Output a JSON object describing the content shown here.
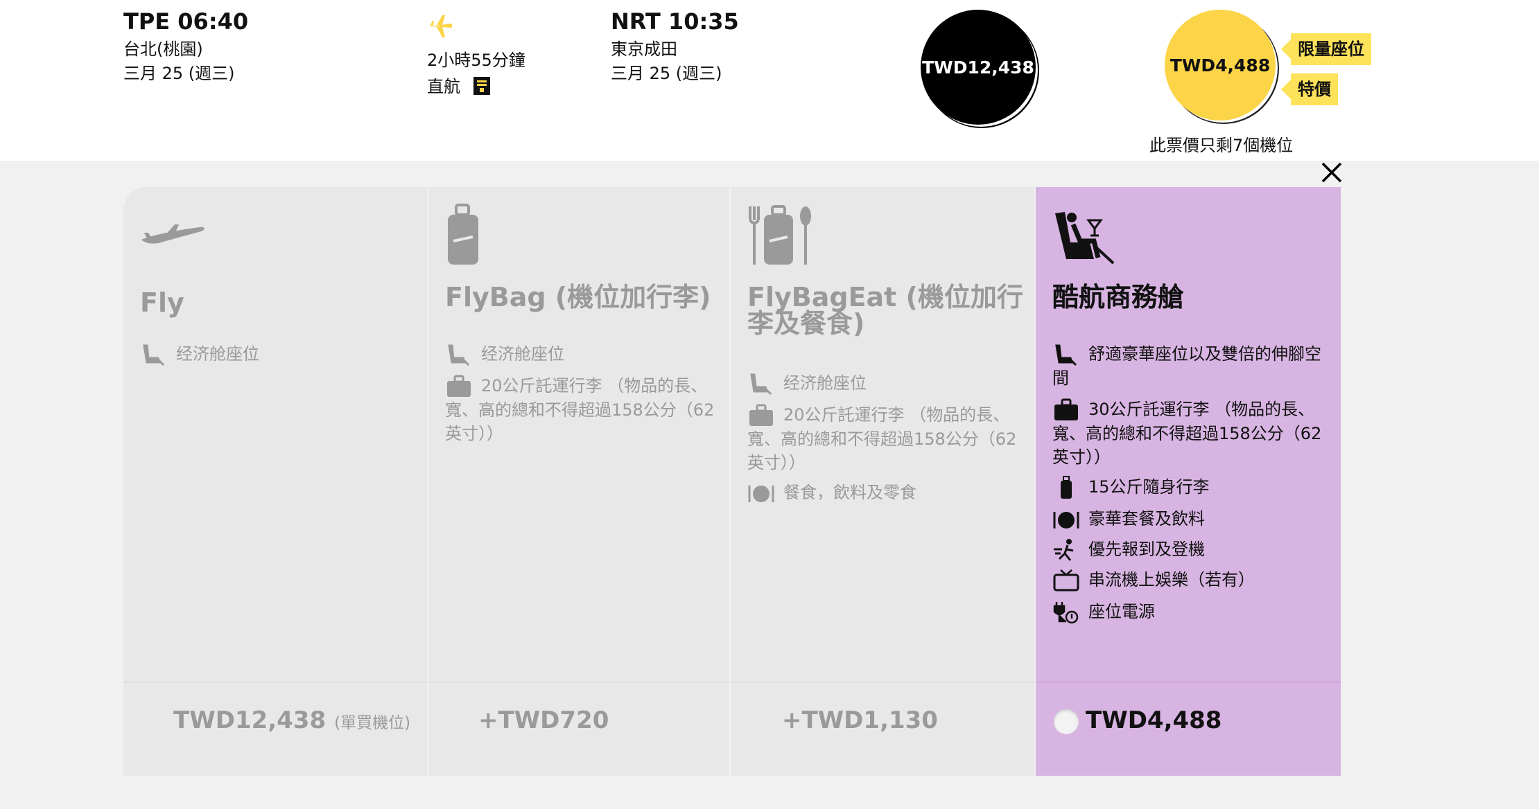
{
  "flight": {
    "departure": {
      "time": "TPE 06:40",
      "city": "台北(桃園)",
      "date": "三月 25 (週三)"
    },
    "duration": "2小時55分鐘",
    "direct": "直航",
    "arrival": {
      "time": "NRT 10:35",
      "city": "東京成田",
      "date": "三月 25 (週三)"
    },
    "price_regular": "TWD12,438",
    "price_deal": "TWD4,488",
    "tags": [
      "限量座位",
      "特價"
    ],
    "seats_left": "此票價只剩7個機位"
  },
  "colors": {
    "accent_yellow": "#fcd447",
    "business_purple": "#d7b4e1",
    "panel_bg": "#f1f1f1",
    "column_bg": "#e8e8e8"
  },
  "fares": [
    {
      "icon": "airplane-icon",
      "name": "Fly",
      "features": [
        {
          "icon": "seat-icon",
          "text": "经济舱座位"
        }
      ],
      "price": "TWD12,438",
      "price_note": "(單買機位)"
    },
    {
      "icon": "suitcase-icon",
      "name": "FlyBag (機位加行李)",
      "features": [
        {
          "icon": "seat-icon",
          "text": "经济舱座位"
        },
        {
          "icon": "checked-bag-icon",
          "text": "20公斤託運行李 （物品的長、寬、高的總和不得超過158公分（62英寸））"
        }
      ],
      "price": "+TWD720"
    },
    {
      "icon": "suitcase-utensils-icon",
      "name": "FlyBagEat (機位加行李及餐食)",
      "features": [
        {
          "icon": "seat-icon",
          "text": "经济舱座位"
        },
        {
          "icon": "checked-bag-icon",
          "text": "20公斤託運行李 （物品的長、寬、高的總和不得超過158公分（62英寸））"
        },
        {
          "icon": "meal-icon",
          "text": "餐食，飲料及零食"
        }
      ],
      "price": "+TWD1,130"
    },
    {
      "icon": "business-seat-icon",
      "name": "酷航商務艙",
      "features": [
        {
          "icon": "seat-icon",
          "text": "舒適豪華座位以及雙倍的伸腳空間"
        },
        {
          "icon": "checked-bag-icon",
          "text": "30公斤託運行李 （物品的長、寬、高的總和不得超過158公分（62英寸））"
        },
        {
          "icon": "carry-on-icon",
          "text": "15公斤隨身行李"
        },
        {
          "icon": "meal-icon",
          "text": "豪華套餐及飲料"
        },
        {
          "icon": "priority-boarding-icon",
          "text": "優先報到及登機"
        },
        {
          "icon": "tv-icon",
          "text": "串流機上娛樂（若有）"
        },
        {
          "icon": "power-outlet-icon",
          "text": "座位電源"
        }
      ],
      "price": "TWD4,488"
    }
  ]
}
